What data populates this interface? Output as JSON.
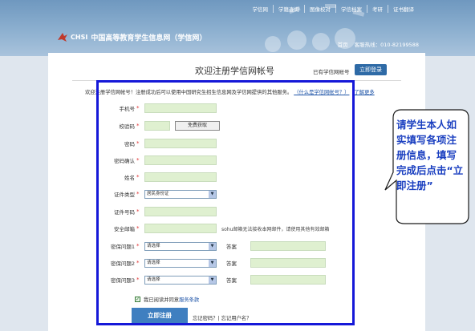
{
  "topnav": {
    "items": [
      "学信网",
      "学籍查询",
      "图像校对",
      "学信档案",
      "考研",
      "证书翻译"
    ]
  },
  "brand": {
    "chsi": "CHSI",
    "name": "中国高等教育学生信息网（学信网）"
  },
  "subnav": {
    "home": "首页",
    "hotline": "客服热线：010-82199588"
  },
  "page": {
    "title": "欢迎注册学信网帐号",
    "already": "已有学信网帐号",
    "login": "立即登录",
    "intro": "欢迎注册学信网帐号！注册成功后可以使用中国研究生招生信息网及学信网提供的其他服务。",
    "intro_link": "（什么是学信网帐号？）",
    "more_link": "了解更多"
  },
  "form": {
    "phone": "手机号",
    "code": "校验码",
    "get_code": "免费获取",
    "password": "密码",
    "confirm": "密码确认",
    "name": "姓名",
    "id_type": "证件类型",
    "id_type_value": "居民身份证",
    "id_no": "证件号码",
    "email": "安全邮箱",
    "email_note": "sohu邮箱无法接收本网邮件，请使用其他有效邮箱",
    "q1": "密保问题1",
    "q2": "密保问题2",
    "q3": "密保问题3",
    "select_placeholder": "请选择",
    "answer": "答案",
    "req": "*",
    "agree_text": "我已阅读并同意",
    "agree_link": "服务条款",
    "submit": "立即注册",
    "forgot": "忘记密码？| 忘记用户名？"
  },
  "callout": {
    "text": "请学生本人如实填写各项注册信息，填写完成后点击“立即注册”"
  }
}
